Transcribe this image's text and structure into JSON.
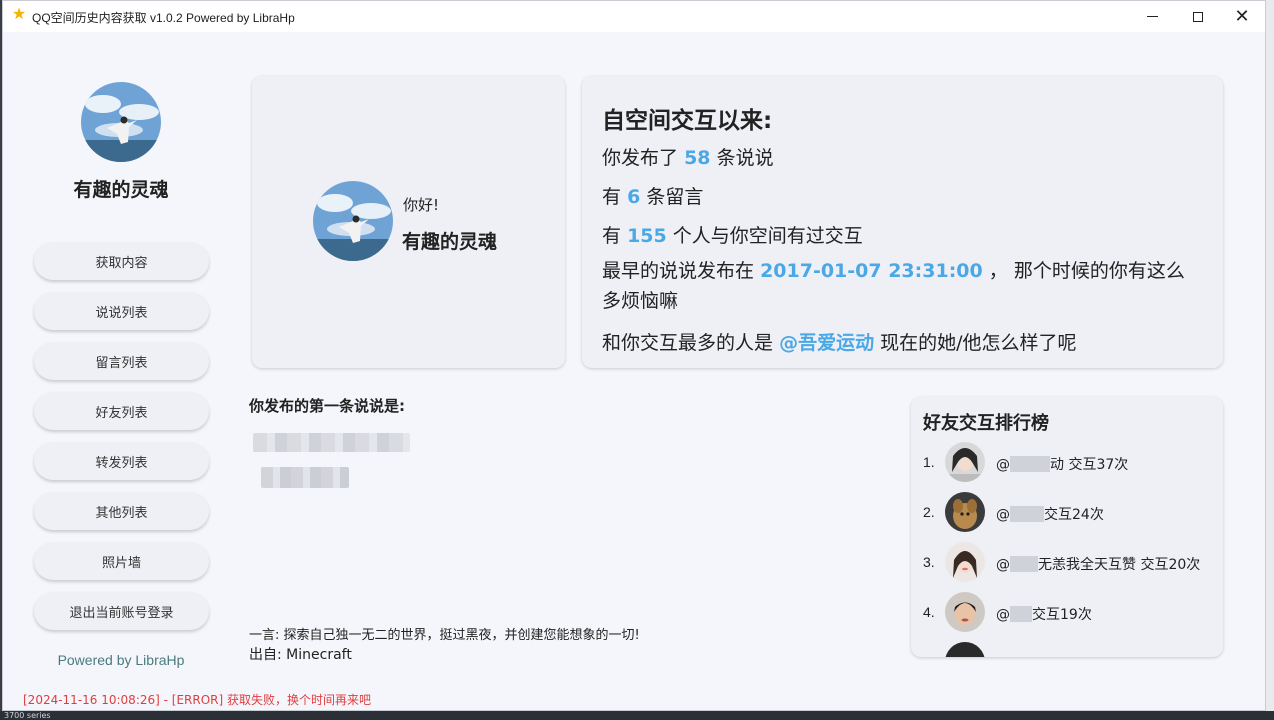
{
  "window": {
    "title": "QQ空间历史内容获取 v1.0.2 Powered by LibraHp"
  },
  "sidebar": {
    "username": "有趣的灵魂",
    "buttons": [
      {
        "label": "获取内容"
      },
      {
        "label": "说说列表"
      },
      {
        "label": "留言列表"
      },
      {
        "label": "好友列表"
      },
      {
        "label": "转发列表"
      },
      {
        "label": "其他列表"
      },
      {
        "label": "照片墙"
      },
      {
        "label": "退出当前账号登录"
      }
    ],
    "powered": "Powered by LibraHp"
  },
  "profile": {
    "greeting": "你好!",
    "name": "有趣的灵魂"
  },
  "stats": {
    "title": "自空间交互以来:",
    "posts_prefix": "你发布了",
    "posts_count": "58",
    "posts_suffix": "条说说",
    "messages_prefix": "有",
    "messages_count": "6",
    "messages_suffix": "条留言",
    "people_prefix": "有",
    "people_count": "155",
    "people_suffix": "个人与你空间有过交互",
    "earliest_prefix": "最早的说说发布在",
    "earliest_time": "2017-01-07 23:31:00",
    "earliest_suffix": "， 那个时候的你有这么多烦恼嘛",
    "top_prefix": "和你交互最多的人是",
    "top_user": "@吾爱运动",
    "top_suffix": "现在的她/他怎么样了呢"
  },
  "first_post": {
    "title": "你发布的第一条说说是:"
  },
  "quote": {
    "text": "一言: 探索自己独一无二的世界，挺过黑夜，并创建您能想象的一切!",
    "source": "出自: Minecraft"
  },
  "ranking": {
    "title": "好友交互排行榜",
    "items": [
      {
        "rank": "1.",
        "at": "@",
        "visible": "动 交互37次"
      },
      {
        "rank": "2.",
        "at": "@",
        "visible": "交互24次"
      },
      {
        "rank": "3.",
        "at": "@",
        "visible": "无恙我全天互赞 交互20次"
      },
      {
        "rank": "4.",
        "at": "@",
        "visible": "交互19次"
      }
    ]
  },
  "status": {
    "message": "[2024-11-16 10:08:26] - [ERROR] 获取失败，换个时间再来吧"
  },
  "desktop": {
    "taskbar_text": "3700 series"
  },
  "colors": {
    "highlight": "#4aa8e6",
    "error": "#e03e3e",
    "powered": "#4a7a7e",
    "card_bg": "#eef0f6",
    "window_bg": "#f5f6fb"
  },
  "icons": {
    "app": "star-icon",
    "minimize": "minimize-icon",
    "maximize": "maximize-icon",
    "close": "close-icon"
  }
}
